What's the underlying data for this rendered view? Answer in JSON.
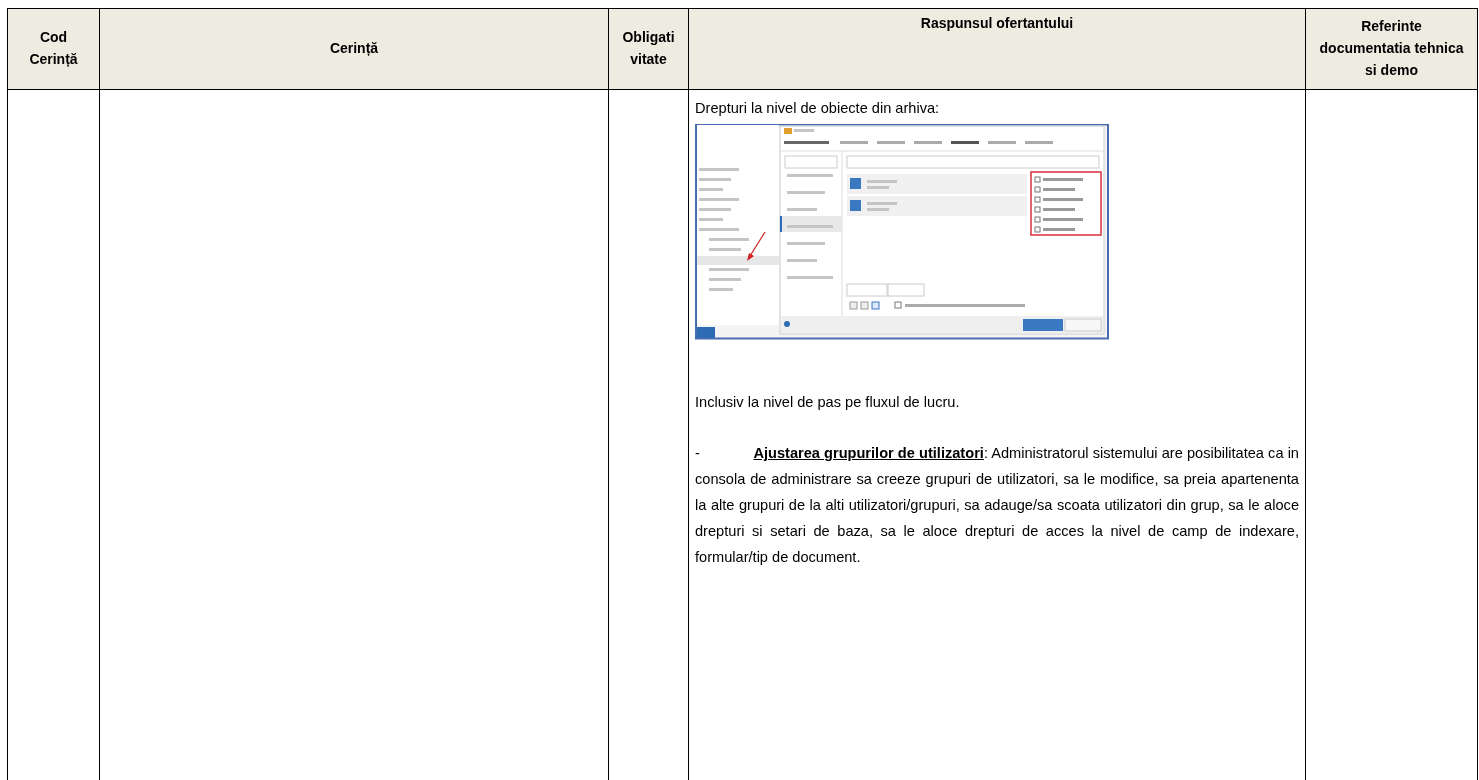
{
  "table": {
    "columns": [
      {
        "label": "Cod Cerință"
      },
      {
        "label": "Cerință"
      },
      {
        "label": "Obligativitate"
      },
      {
        "label": "Raspunsul ofertantului"
      },
      {
        "label": "Referinte documentatia tehnica si demo"
      }
    ],
    "response": {
      "caption": "Drepturi la nivel de obiecte din arhiva:",
      "note": "Inclusiv la nivel de pas pe fluxul de lucru.",
      "paragraph": "-             **Ajustarea grupurilor de utilizatori**: Administratorul sistemului are posibilitatea ca in consola de administrare sa creeze grupuri de utilizatori, sa le modifice, sa preia apartenenta la alte grupuri de la alti utilizatori/grupuri, sa adauge/sa scoata utilizatori din grup, sa le aloce drepturi si setari de baza, sa le aloce drepturi de acces la nivel de camp de indexare, formular/tip de document."
    }
  }
}
